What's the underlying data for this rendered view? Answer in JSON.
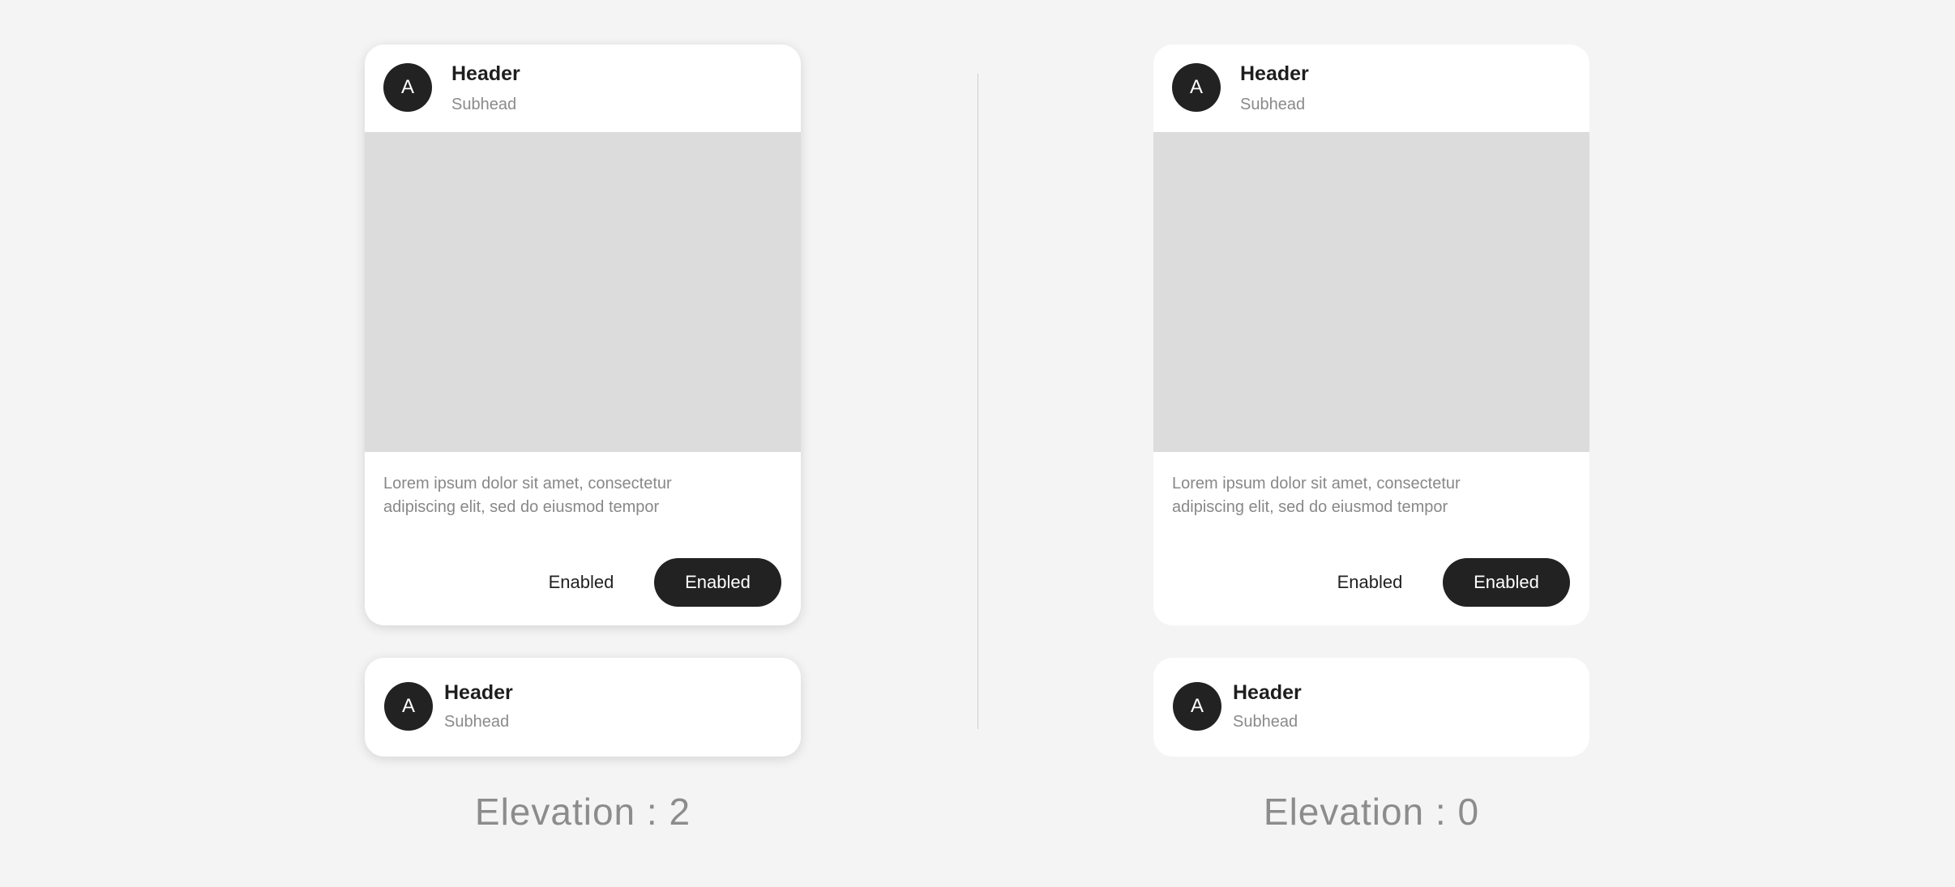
{
  "columns": [
    {
      "elevation_label": "Elevation : 2",
      "card": {
        "avatar": "A",
        "header": "Header",
        "subhead": "Subhead",
        "body": "Lorem ipsum dolor sit amet, consectetur adipiscing elit, sed do eiusmod tempor",
        "text_button": "Enabled",
        "filled_button": "Enabled"
      },
      "compact_card": {
        "avatar": "A",
        "header": "Header",
        "subhead": "Subhead"
      }
    },
    {
      "elevation_label": "Elevation : 0",
      "card": {
        "avatar": "A",
        "header": "Header",
        "subhead": "Subhead",
        "body": "Lorem ipsum dolor sit amet, consectetur adipiscing elit, sed do eiusmod tempor",
        "text_button": "Enabled",
        "filled_button": "Enabled"
      },
      "compact_card": {
        "avatar": "A",
        "header": "Header",
        "subhead": "Subhead"
      }
    }
  ],
  "colors": {
    "background": "#f4f4f4",
    "card": "#ffffff",
    "media": "#dcdcdc",
    "primary": "#222222"
  }
}
